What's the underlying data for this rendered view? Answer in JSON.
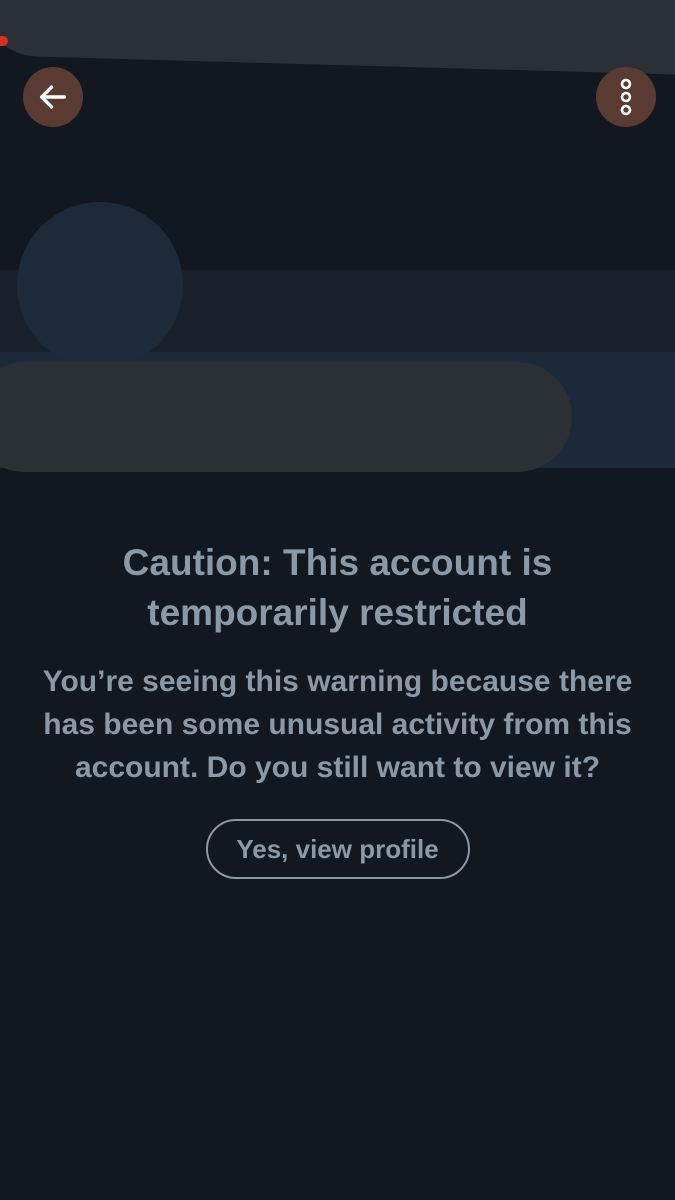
{
  "header": {
    "back_icon": "arrow-left-icon",
    "more_icon": "more-vertical-icon"
  },
  "colors": {
    "background": "#121820",
    "icon_button_bg": "#5a3b31",
    "text_secondary": "#8b98a5"
  },
  "warning": {
    "title": "Caution: This account is temporarily restricted",
    "body": "You’re seeing this warning because there has been some unusual activity from this account. Do you still want to view it?",
    "button_label": "Yes, view profile"
  }
}
